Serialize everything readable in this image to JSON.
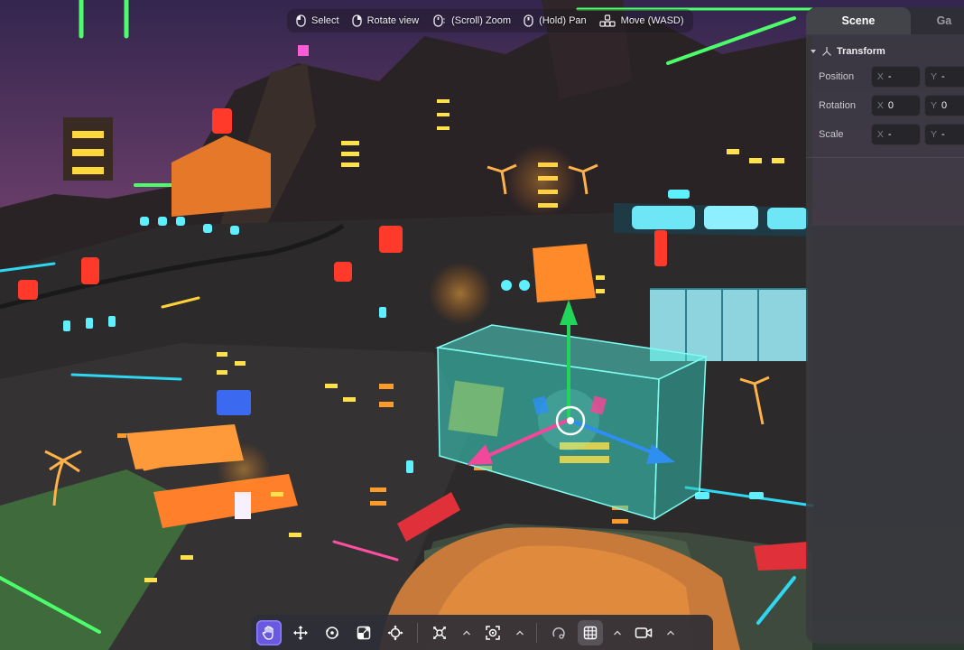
{
  "viewport_hints": [
    {
      "icon": "mouse-left-icon",
      "label": "Select"
    },
    {
      "icon": "mouse-right-icon",
      "label": "Rotate view"
    },
    {
      "icon": "mouse-scroll-icon",
      "label": "(Scroll) Zoom"
    },
    {
      "icon": "mouse-middle-icon",
      "label": "(Hold) Pan"
    },
    {
      "icon": "wasd-keys-icon",
      "label": "Move (WASD)"
    }
  ],
  "inspector": {
    "tabs": [
      {
        "label": "Scene",
        "active": true
      },
      {
        "label": "Ga",
        "active": false
      }
    ],
    "transform": {
      "title": "Transform",
      "icon": "transform-axes-icon",
      "rows": [
        {
          "label": "Position",
          "x": "-",
          "y": "-"
        },
        {
          "label": "Rotation",
          "x": "0",
          "y": "0"
        },
        {
          "label": "Scale",
          "x": "-",
          "y": "-"
        }
      ],
      "axis_x": "X",
      "axis_y": "Y"
    }
  },
  "toolbar": {
    "tools": [
      {
        "name": "hand-tool-button",
        "icon": "hand-icon",
        "state": "active"
      },
      {
        "name": "move-tool-button",
        "icon": "move-arrows-icon",
        "state": "normal"
      },
      {
        "name": "rotate-tool-button",
        "icon": "rotate-icon",
        "state": "normal"
      },
      {
        "name": "scale-tool-button",
        "icon": "scale-icon",
        "state": "normal"
      },
      {
        "name": "transform-tool-button",
        "icon": "crosshair-move-icon",
        "state": "normal"
      }
    ],
    "groups": [
      {
        "name": "pivot-mode-button",
        "icon": "pivot-icon",
        "state": "normal"
      },
      {
        "name": "snap-button",
        "icon": "snap-target-icon",
        "state": "normal"
      },
      {
        "name": "local-global-button",
        "icon": "orbit-icon",
        "state": "normal"
      },
      {
        "name": "grid-toggle-button",
        "icon": "grid-icon",
        "state": "pressed"
      },
      {
        "name": "camera-button",
        "icon": "camera-icon",
        "state": "normal"
      }
    ]
  },
  "colors": {
    "accent": "#6a58e0",
    "gizmo_y": "#22d45a",
    "gizmo_x": "#2e8ff0",
    "gizmo_z": "#f0489a",
    "selection": "#4fe8d8"
  }
}
